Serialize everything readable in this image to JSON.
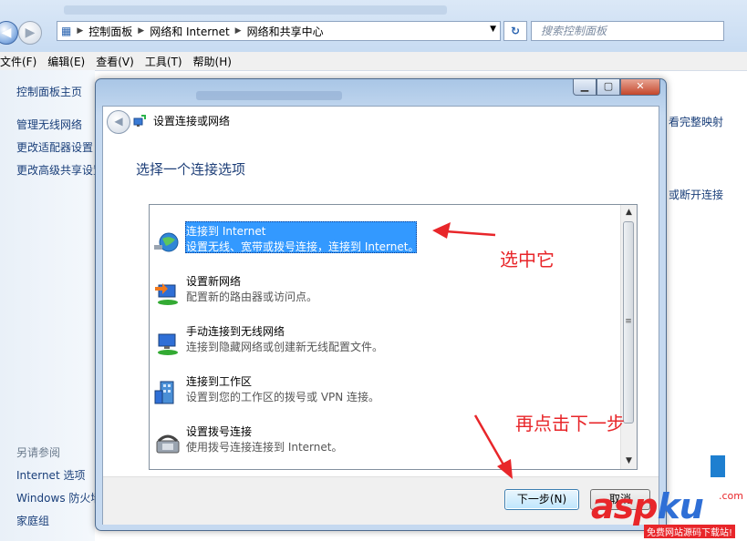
{
  "explorer": {
    "breadcrumb": [
      "控制面板",
      "网络和 Internet",
      "网络和共享中心"
    ],
    "search_placeholder": "搜索控制面板",
    "menu": [
      "文件(F)",
      "编辑(E)",
      "查看(V)",
      "工具(T)",
      "帮助(H)"
    ],
    "leftnav": {
      "home": "控制面板主页",
      "links": [
        "管理无线网络",
        "更改适配器设置",
        "更改高级共享设置"
      ],
      "see_also": "另请参阅",
      "see_also_links": [
        "Internet 选项",
        "Windows 防火墙",
        "家庭组"
      ]
    },
    "right_peek": [
      "看完整映射",
      "或断开连接"
    ]
  },
  "dialog": {
    "title": "设置连接或网络",
    "section_title": "选择一个连接选项",
    "items": [
      {
        "title": "连接到 Internet",
        "desc": "设置无线、宽带或拨号连接，连接到 Internet。"
      },
      {
        "title": "设置新网络",
        "desc": "配置新的路由器或访问点。"
      },
      {
        "title": "手动连接到无线网络",
        "desc": "连接到隐藏网络或创建新无线配置文件。"
      },
      {
        "title": "连接到工作区",
        "desc": "设置到您的工作区的拨号或 VPN 连接。"
      },
      {
        "title": "设置拨号连接",
        "desc": "使用拨号连接连接到 Internet。"
      }
    ],
    "next_label": "下一步(N)",
    "cancel_label": "取消"
  },
  "annotations": {
    "select_it": "选中它",
    "click_next": "再点击下一步"
  },
  "watermark": {
    "brand_red": "asp",
    "brand_blue": "ku",
    "tld": ".com",
    "slogan": "免费网站源码下载站!"
  },
  "colors": {
    "selection": "#3399ff",
    "annotation": "#e8262a",
    "link": "#1a3f7a"
  }
}
